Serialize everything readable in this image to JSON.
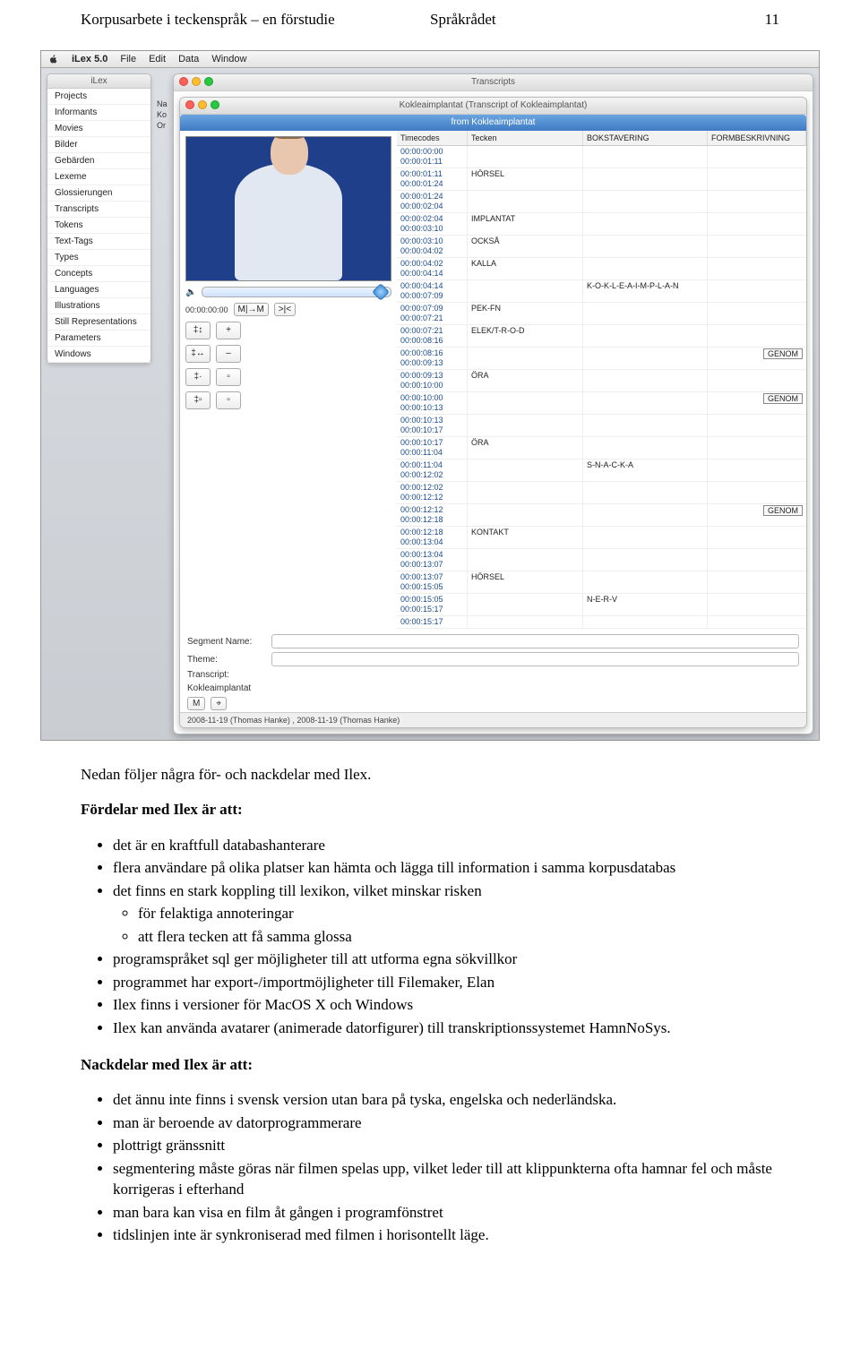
{
  "header": {
    "left": "Korpusarbete i teckenspråk – en förstudie",
    "center": "Språkrådet",
    "right": "11"
  },
  "menubar": {
    "app": "iLex 5.0",
    "items": [
      "File",
      "Edit",
      "Data",
      "Window"
    ]
  },
  "ilex_panel": {
    "title": "iLex",
    "items": [
      "Projects",
      "Informants",
      "Movies",
      "Bilder",
      "Gebärden",
      "Lexeme",
      "Glossierungen",
      "Transcripts",
      "Tokens",
      "Text-Tags",
      "Types",
      "Concepts",
      "Languages",
      "Illustrations",
      "Still Representations",
      "Parameters",
      "Windows"
    ]
  },
  "stub": [
    "Na",
    "Ko",
    "Or"
  ],
  "outer_window": {
    "title": "Transcripts"
  },
  "inner_window": {
    "title": "Kokleaimplantat (Transcript of Kokleaimplantat)",
    "band": "from Kokleaimplantat",
    "timecode_label": "00:00:00:00",
    "play1": "M|→M",
    "play2": ">|<",
    "tool_btns": [
      "‡↕",
      "+",
      "‡↔",
      "–",
      "‡·",
      "▫",
      "‡▫",
      "▫"
    ],
    "segment_label": "Segment Name:",
    "theme_label": "Theme:",
    "transcript_label": "Transcript:",
    "transcript_value": "Kokleaimplantat",
    "chips": [
      "M",
      "⌖"
    ],
    "status": "2008-11-19 (Thomas Hanke) , 2008-11-19 (Thomas Hanke)"
  },
  "annot_head": {
    "c0": "Timecodes",
    "c1": "Tecken",
    "c2": "BOKSTAVERING",
    "c3": "FORMBESKRIVNING"
  },
  "annot_rows": [
    {
      "t1": "00:00:00:00",
      "t2": "00:00:01:11",
      "a": "",
      "b": "",
      "c": ""
    },
    {
      "t1": "00:00:01:11",
      "t2": "00:00:01:24",
      "a": "HÖRSEL",
      "b": "",
      "c": ""
    },
    {
      "t1": "00:00:01:24",
      "t2": "00:00:02:04",
      "a": "",
      "b": "",
      "c": ""
    },
    {
      "t1": "00:00:02:04",
      "t2": "00:00:03:10",
      "a": "IMPLANTAT",
      "b": "",
      "c": ""
    },
    {
      "t1": "00:00:03:10",
      "t2": "00:00:04:02",
      "a": "OCKSÅ",
      "b": "",
      "c": ""
    },
    {
      "t1": "00:00:04:02",
      "t2": "00:00:04:14",
      "a": "KALLA",
      "b": "",
      "c": ""
    },
    {
      "t1": "00:00:04:14",
      "t2": "00:00:07:09",
      "a": "",
      "b": "K-O-K-L-E-A-I-M-P-L-A-N",
      "c": ""
    },
    {
      "t1": "00:00:07:09",
      "t2": "00:00:07:21",
      "a": "PEK-FN",
      "b": "",
      "c": ""
    },
    {
      "t1": "00:00:07:21",
      "t2": "00:00:08:16",
      "a": "ELEK/T-R-O-D",
      "b": "",
      "c": ""
    },
    {
      "t1": "00:00:08:16",
      "t2": "00:00:09:13",
      "a": "",
      "b": "",
      "c": "GENOM"
    },
    {
      "t1": "00:00:09:13",
      "t2": "00:00:10:00",
      "a": "ÖRA",
      "b": "",
      "c": ""
    },
    {
      "t1": "00:00:10:00",
      "t2": "00:00:10:13",
      "a": "",
      "b": "",
      "c": "GENOM"
    },
    {
      "t1": "00:00:10:13",
      "t2": "00:00:10:17",
      "a": "",
      "b": "",
      "c": ""
    },
    {
      "t1": "00:00:10:17",
      "t2": "00:00:11:04",
      "a": "ÖRA",
      "b": "",
      "c": ""
    },
    {
      "t1": "00:00:11:04",
      "t2": "00:00:12:02",
      "a": "",
      "b": "S-N-A-C-K-A",
      "c": ""
    },
    {
      "t1": "00:00:12:02",
      "t2": "00:00:12:12",
      "a": "",
      "b": "",
      "c": ""
    },
    {
      "t1": "00:00:12:12",
      "t2": "00:00:12:18",
      "a": "",
      "b": "",
      "c": "GENOM"
    },
    {
      "t1": "00:00:12:18",
      "t2": "00:00:13:04",
      "a": "KONTAKT",
      "b": "",
      "c": ""
    },
    {
      "t1": "00:00:13:04",
      "t2": "00:00:13:07",
      "a": "",
      "b": "",
      "c": ""
    },
    {
      "t1": "00:00:13:07",
      "t2": "00:00:15:05",
      "a": "HÖRSEL",
      "b": "",
      "c": ""
    },
    {
      "t1": "00:00:15:05",
      "t2": "00:00:15:17",
      "a": "",
      "b": "N-E-R-V",
      "c": ""
    },
    {
      "t1": "00:00:15:17",
      "t2": "",
      "a": "",
      "b": "",
      "c": ""
    }
  ],
  "text": {
    "intro": "Nedan följer några för- och nackdelar med Ilex.",
    "fordelar_title": "Fördelar med Ilex är att:",
    "fordelar": [
      "det är en kraftfull databashanterare",
      "flera användare på olika platser kan hämta och lägga till information i samma korpusdatabas",
      "det finns en stark koppling till lexikon, vilket minskar risken",
      "programspråket sql ger möjligheter till att utforma egna sökvillkor",
      "programmet har export-/importmöjligheter till Filemaker, Elan",
      "Ilex finns i versioner för MacOS X och Windows",
      "Ilex kan använda avatarer (animerade datorfigurer) till transkriptionssystemet HamnNoSys."
    ],
    "fordelar_sub": [
      "för felaktiga annoteringar",
      "att flera tecken att få samma glossa"
    ],
    "nackdelar_title": "Nackdelar med Ilex är att:",
    "nackdelar": [
      "det ännu inte finns i svensk version utan bara på tyska, engelska och nederländska.",
      "man är beroende av datorprogrammerare",
      "plottrigt gränssnitt",
      "segmentering måste göras när filmen spelas upp, vilket leder till att klippunkterna ofta hamnar fel och måste korrigeras i efterhand",
      "man bara kan visa en film åt gången i programfönstret",
      "tidslinjen inte är synkroniserad med filmen i horisontellt läge."
    ]
  }
}
